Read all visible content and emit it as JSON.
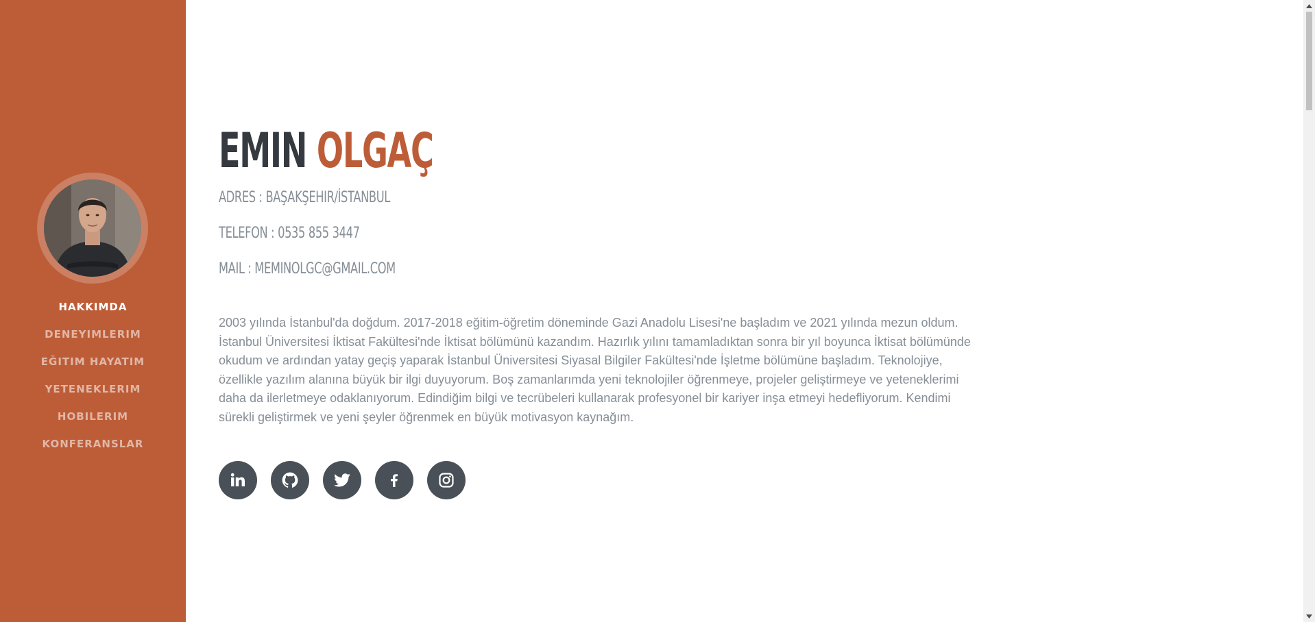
{
  "sidebar": {
    "avatar_alt": "profile photo",
    "nav": [
      {
        "label": "HAKKIMDA",
        "active": true
      },
      {
        "label": "DENEYIMLERIM",
        "active": false
      },
      {
        "label": "EĞITIM HAYATIM",
        "active": false
      },
      {
        "label": "YETENEKLERIM",
        "active": false
      },
      {
        "label": "HOBILERIM",
        "active": false
      },
      {
        "label": "KONFERANSLAR",
        "active": false
      }
    ]
  },
  "profile": {
    "first_name": "EMIN",
    "last_name": "OLGAÇ",
    "address": "ADRES : BAŞAKŞEHIR/İSTANBUL",
    "phone": "TELEFON : 0535 855 3447",
    "mail": "MAIL : MEMINOLGC@GMAIL.COM",
    "bio": "2003 yılında İstanbul'da doğdum. 2017-2018 eğitim-öğretim döneminde Gazi Anadolu Lisesi'ne başladım ve 2021 yılında mezun oldum. İstanbul Üniversitesi İktisat Fakültesi'nde İktisat bölümünü kazandım. Hazırlık yılını tamamladıktan sonra bir yıl boyunca İktisat bölümünde okudum ve ardından yatay geçiş yaparak İstanbul Üniversitesi Siyasal Bilgiler Fakültesi'nde İşletme bölümüne başladım. Teknolojiye, özellikle yazılım alanına büyük bir ilgi duyuyorum. Boş zamanlarımda yeni teknolojiler öğrenmeye, projeler geliştirmeye ve yeteneklerimi daha da ilerletmeye odaklanıyorum. Edindiğim bilgi ve tecrübeleri kullanarak profesyonel bir kariyer inşa etmeyi hedefliyorum. Kendimi sürekli geliştirmek ve yeni şeyler öğrenmek en büyük motivasyon kaynağım."
  },
  "socials": [
    {
      "icon": "linkedin-icon"
    },
    {
      "icon": "github-icon"
    },
    {
      "icon": "twitter-icon"
    },
    {
      "icon": "facebook-icon"
    },
    {
      "icon": "instagram-icon"
    }
  ],
  "colors": {
    "primary": "#bd5d38",
    "dark": "#343a40",
    "muted": "#868e96",
    "social_bg": "#495057"
  }
}
